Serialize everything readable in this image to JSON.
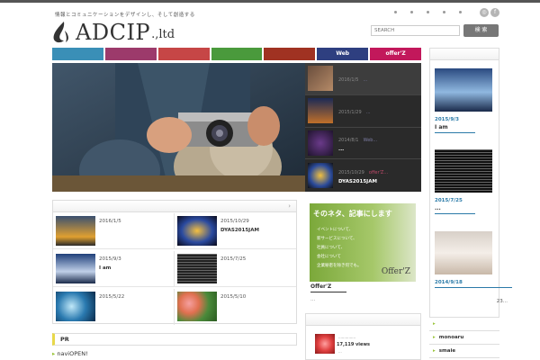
{
  "header": {
    "tagline": "情報とコミュニケーションをデザインし、そして創造する",
    "logo_main": "ADCIP",
    "logo_sub": ".,ltd",
    "search_placeholder": "SEARCH",
    "search_button": "検 索",
    "social": [
      {
        "icon": "rss-icon",
        "glyph": "◎"
      },
      {
        "icon": "facebook-icon",
        "glyph": "f"
      }
    ]
  },
  "nav": [
    {
      "label": "",
      "color": "#3a8fb7"
    },
    {
      "label": "",
      "color": "#9c3a6b"
    },
    {
      "label": "",
      "color": "#c64646"
    },
    {
      "label": "",
      "color": "#4a9a3c"
    },
    {
      "label": "",
      "color": "#a03222"
    },
    {
      "label": "Web",
      "color": "#2e3f80"
    },
    {
      "label": "offer'Z",
      "color": "#c2185b"
    }
  ],
  "slider": [
    {
      "date": "2016/1/5",
      "cat": "...",
      "title": "",
      "cat_pink": false
    },
    {
      "date": "2015/1/29",
      "cat": "...",
      "title": "",
      "cat_pink": false
    },
    {
      "date": "2014/8/1",
      "cat": "Web...",
      "title": "...",
      "cat_pink": false
    },
    {
      "date": "2015/10/29",
      "cat": "offer'Z...",
      "title": "DYAS2015JAM",
      "cat_pink": true
    }
  ],
  "grid": [
    {
      "date": "2016/1/5",
      "title": ""
    },
    {
      "date": "2015/10/29",
      "title": "DYAS2015JAM"
    },
    {
      "date": "2015/9/3",
      "title": "I am"
    },
    {
      "date": "2015/7/25",
      "title": ""
    },
    {
      "date": "2015/5/22",
      "title": ""
    },
    {
      "date": "2015/5/10",
      "title": ""
    }
  ],
  "offer": {
    "banner_heading": "そのネタ、記事にします",
    "banner_lines": [
      "イベントについて、",
      "新サービスについて、",
      "社員について、",
      "会社について",
      "企業秘密を除き何でも。"
    ],
    "banner_logo": "Offer'Z",
    "title": "Offer'Z",
    "excerpt": "..."
  },
  "popular": {
    "title": "...............",
    "views": "17,119 views",
    "extra": "..."
  },
  "sidebar": {
    "items": [
      {
        "date": "2015/9/3",
        "caption": "I am"
      },
      {
        "date": "2015/7/25",
        "caption": "..."
      },
      {
        "date": "2014/9/18",
        "caption": ""
      }
    ],
    "more": "23..."
  },
  "sidebar_list": [
    "",
    "monoaru",
    "smaie"
  ],
  "pr": {
    "title": "PR",
    "link": "naviOPEN!"
  },
  "box_arrow": "›"
}
